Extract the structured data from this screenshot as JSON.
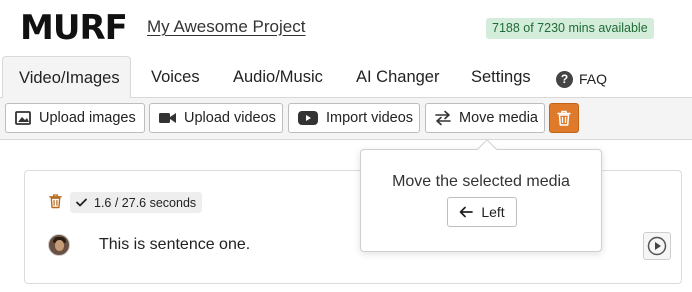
{
  "header": {
    "logo": "MURF",
    "project_title": "My Awesome Project",
    "mins_available": "7188 of 7230 mins available"
  },
  "tabs": [
    {
      "label": "Video/Images",
      "active": true
    },
    {
      "label": "Voices",
      "active": false
    },
    {
      "label": "Audio/Music",
      "active": false
    },
    {
      "label": "AI Changer",
      "active": false
    },
    {
      "label": "Settings",
      "active": false
    }
  ],
  "faq": {
    "label": "FAQ",
    "icon": "question-circle-icon"
  },
  "toolbar": {
    "upload_images": {
      "label": "Upload images",
      "icon": "image-icon"
    },
    "upload_videos": {
      "label": "Upload videos",
      "icon": "video-camera-icon"
    },
    "import_videos": {
      "label": "Import videos",
      "icon": "youtube-icon"
    },
    "move_media": {
      "label": "Move media",
      "icon": "swap-arrows-icon"
    },
    "delete": {
      "icon": "trash-icon",
      "color": "#de7a2a"
    }
  },
  "popover": {
    "title": "Move the selected media",
    "left_button": "Left"
  },
  "block": {
    "duration": "1.6 / 27.6 seconds",
    "sentence": "This is sentence one."
  },
  "colors": {
    "badge_bg": "#d4edda",
    "badge_text": "#1e6b36",
    "accent": "#de7a2a"
  }
}
